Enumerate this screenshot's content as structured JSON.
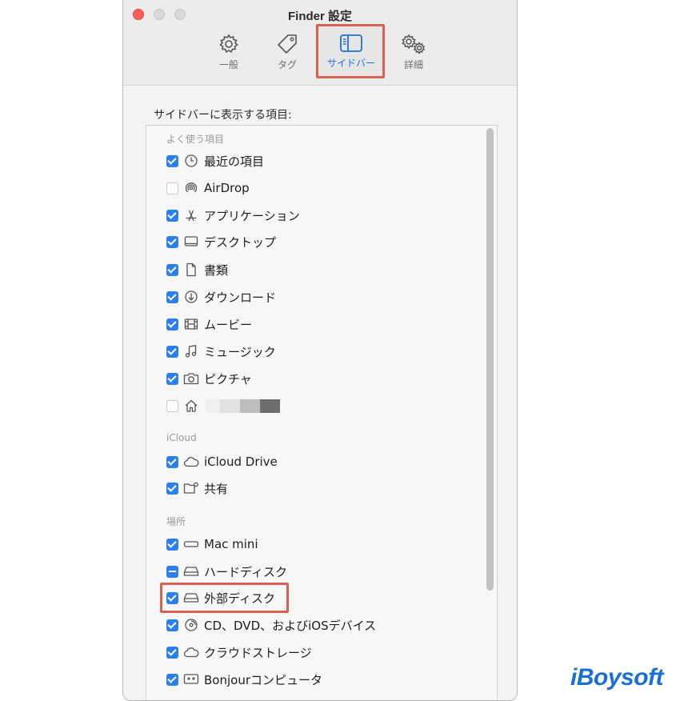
{
  "window": {
    "title": "Finder 設定",
    "tabs": [
      {
        "label": "一般",
        "icon": "gear-icon"
      },
      {
        "label": "タグ",
        "icon": "tag-icon"
      },
      {
        "label": "サイドバー",
        "icon": "sidebar-icon",
        "selected": true
      },
      {
        "label": "詳細",
        "icon": "gears-icon"
      }
    ]
  },
  "sidebar_settings": {
    "header": "サイドバーに表示する項目:",
    "groups": {
      "favorites": "よく使う項目",
      "icloud": "iCloud",
      "locations": "場所"
    },
    "items": [
      {
        "label": "最近の項目",
        "icon": "clock-icon",
        "checked": true
      },
      {
        "label": "AirDrop",
        "icon": "airdrop-icon",
        "checked": false
      },
      {
        "label": "アプリケーション",
        "icon": "applications-icon",
        "checked": true
      },
      {
        "label": "デスクトップ",
        "icon": "desktop-icon",
        "checked": true
      },
      {
        "label": "書類",
        "icon": "document-icon",
        "checked": true
      },
      {
        "label": "ダウンロード",
        "icon": "download-icon",
        "checked": true
      },
      {
        "label": "ムービー",
        "icon": "film-icon",
        "checked": true
      },
      {
        "label": "ミュージック",
        "icon": "music-icon",
        "checked": true
      },
      {
        "label": "ピクチャ",
        "icon": "camera-icon",
        "checked": true
      },
      {
        "label": "",
        "icon": "home-icon",
        "checked": false,
        "redacted": true
      },
      {
        "label": "iCloud Drive",
        "icon": "cloud-icon",
        "checked": true
      },
      {
        "label": "共有",
        "icon": "shared-folder-icon",
        "checked": true
      },
      {
        "label": "Mac mini",
        "icon": "mac-mini-icon",
        "checked": true
      },
      {
        "label": "ハードディスク",
        "icon": "hard-disk-icon",
        "checked": "mixed"
      },
      {
        "label": "外部ディスク",
        "icon": "external-disk-icon",
        "checked": true,
        "highlighted": true
      },
      {
        "label": "CD、DVD、およびiOSデバイス",
        "icon": "cd-icon",
        "checked": true
      },
      {
        "label": "クラウドストレージ",
        "icon": "cloud-storage-icon",
        "checked": true
      },
      {
        "label": "Bonjourコンピュータ",
        "icon": "bonjour-icon",
        "checked": true
      }
    ]
  },
  "watermark": "iBoysoft",
  "colors": {
    "accent": "#2b7ff0",
    "highlight": "#d9614f",
    "close": "#fe5f57",
    "logo": "#1a6fd6"
  }
}
